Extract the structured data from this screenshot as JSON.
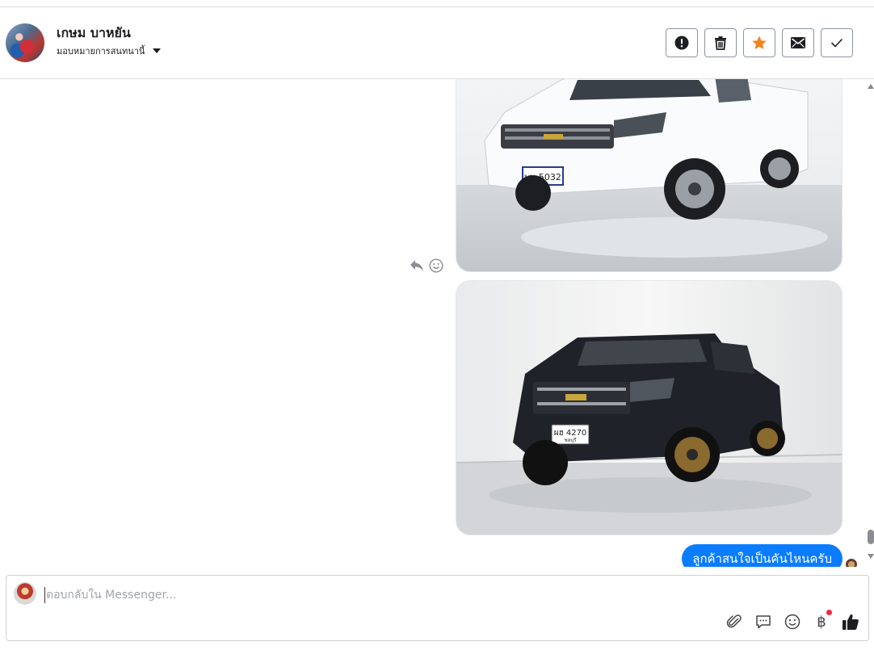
{
  "header": {
    "contact_name": "เกษม บาหยัน",
    "assign_label": "มอบหมายการสนทนานี้",
    "actions": [
      {
        "name": "report-button",
        "icon": "exclamation-icon"
      },
      {
        "name": "delete-button",
        "icon": "trash-icon"
      },
      {
        "name": "star-button",
        "icon": "star-icon"
      },
      {
        "name": "mark-unread-button",
        "icon": "envelope-icon"
      },
      {
        "name": "mark-done-button",
        "icon": "checkmark-icon"
      }
    ]
  },
  "conversation": {
    "images": [
      {
        "alt": "white pickup truck",
        "plate": "บษ 5032"
      },
      {
        "alt": "black pickup truck",
        "plate": "ผฮ 4270",
        "plate_sub": "ชลบุรี"
      }
    ],
    "outgoing_message": "ลูกค้าสนใจเป็นคันไหนครับ"
  },
  "composer": {
    "placeholder": "ตอบกลับใน Messenger...",
    "value": ""
  },
  "colors": {
    "bubble": "#0a7cff",
    "star": "#f5821f",
    "notification_dot": "#f02849"
  }
}
